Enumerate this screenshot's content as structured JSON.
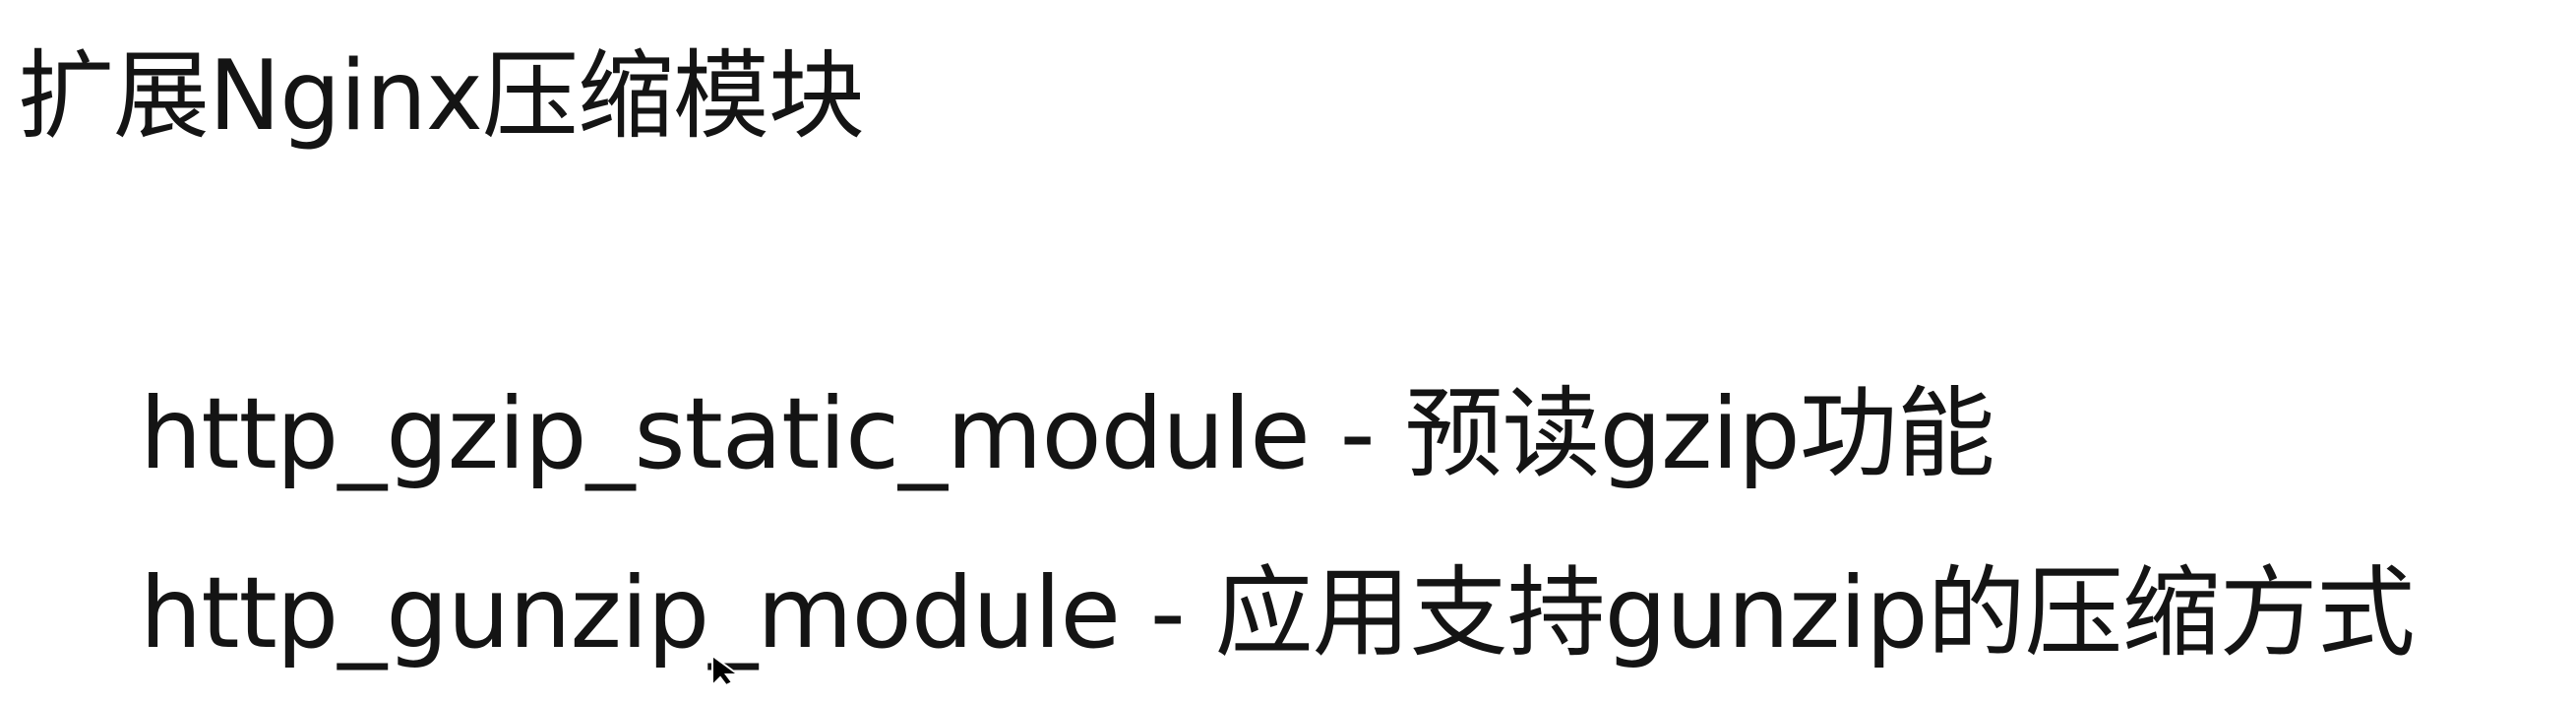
{
  "slide": {
    "title": "扩展Nginx压缩模块",
    "items": [
      "http_gzip_static_module - 预读gzip功能",
      "http_gunzip_module - 应用支持gunzip的压缩方式"
    ]
  },
  "icons": {
    "pointer": "mouse-pointer-icon"
  }
}
